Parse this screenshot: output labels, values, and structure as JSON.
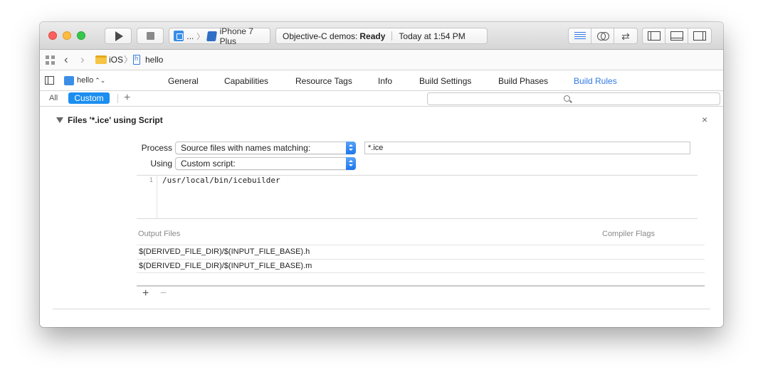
{
  "toolbar": {
    "scheme_truncated": "...",
    "scheme_sep": "〉",
    "device": "iPhone 7 Plus",
    "activity_project": "Objective-C demos:",
    "activity_status": "Ready",
    "activity_time": "Today at 1:54 PM"
  },
  "jumpbar": {
    "folder": "iOS",
    "sep": "〉",
    "file": "hello"
  },
  "tabbar": {
    "target": "hello",
    "target_updown": "⌃⌄",
    "tabs": [
      "General",
      "Capabilities",
      "Resource Tags",
      "Info",
      "Build Settings",
      "Build Phases",
      "Build Rules"
    ],
    "active_tab": "Build Rules"
  },
  "filter": {
    "all": "All",
    "custom": "Custom",
    "add": "+",
    "search_value": ""
  },
  "rule": {
    "title": "Files '*.ice' using Script",
    "close": "×",
    "process_label": "Process",
    "process_value": "Source files with names matching:",
    "pattern_value": "*.ice",
    "using_label": "Using",
    "using_value": "Custom script:",
    "script_line_number": "1",
    "script_line": "/usr/local/bin/icebuilder",
    "output_files_header": "Output Files",
    "compiler_flags_header": "Compiler Flags",
    "output_files": [
      "$(DERIVED_FILE_DIR)/$(INPUT_FILE_BASE).h",
      "$(DERIVED_FILE_DIR)/$(INPUT_FILE_BASE).m"
    ],
    "add": "+",
    "remove": "−"
  },
  "colors": {
    "accent": "#1b8ef0",
    "active_tab": "#2f79e3",
    "close_button": "#fc605c",
    "minimize_button": "#fdbc40",
    "zoom_button": "#34c84a"
  }
}
